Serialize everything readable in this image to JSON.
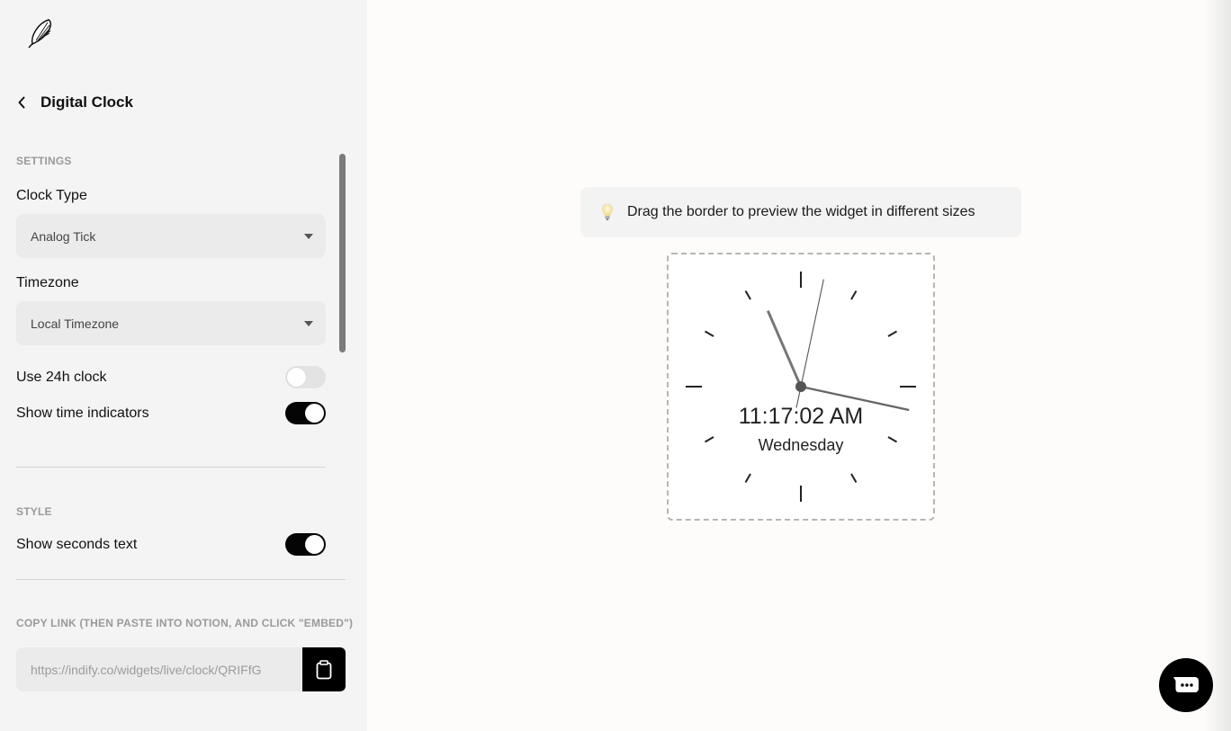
{
  "header": {
    "logo_icon": "feather-icon",
    "back_icon": "chevron-left-icon",
    "title": "Digital Clock"
  },
  "settings": {
    "section_label": "SETTINGS",
    "clock_type": {
      "label": "Clock Type",
      "value": "Analog Tick"
    },
    "timezone": {
      "label": "Timezone",
      "value": "Local Timezone"
    },
    "use_24h": {
      "label": "Use 24h clock",
      "on": false
    },
    "show_indicators": {
      "label": "Show time indicators",
      "on": true
    }
  },
  "style": {
    "section_label": "STYLE",
    "show_seconds": {
      "label": "Show seconds text",
      "on": true
    }
  },
  "copy_link": {
    "label": "COPY LINK (THEN PASTE INTO NOTION, AND CLICK \"EMBED\")",
    "url": "https://indify.co/widgets/live/clock/QRIFfG",
    "button_icon": "clipboard-icon"
  },
  "preview": {
    "hint_icon": "lightbulb-icon",
    "hint": "Drag the border to preview the widget in different sizes",
    "clock": {
      "time_text": "11:17:02 AM",
      "day_text": "Wednesday",
      "hours": 11,
      "minutes": 17,
      "seconds": 2
    }
  },
  "chat": {
    "icon": "chat-bubble-icon"
  },
  "colors": {
    "sidebar_bg": "#f4f4f4",
    "main_bg": "#fdfcfa",
    "toggle_on": "#050505",
    "toggle_off": "#e3e3e3",
    "accent": "#000000"
  }
}
